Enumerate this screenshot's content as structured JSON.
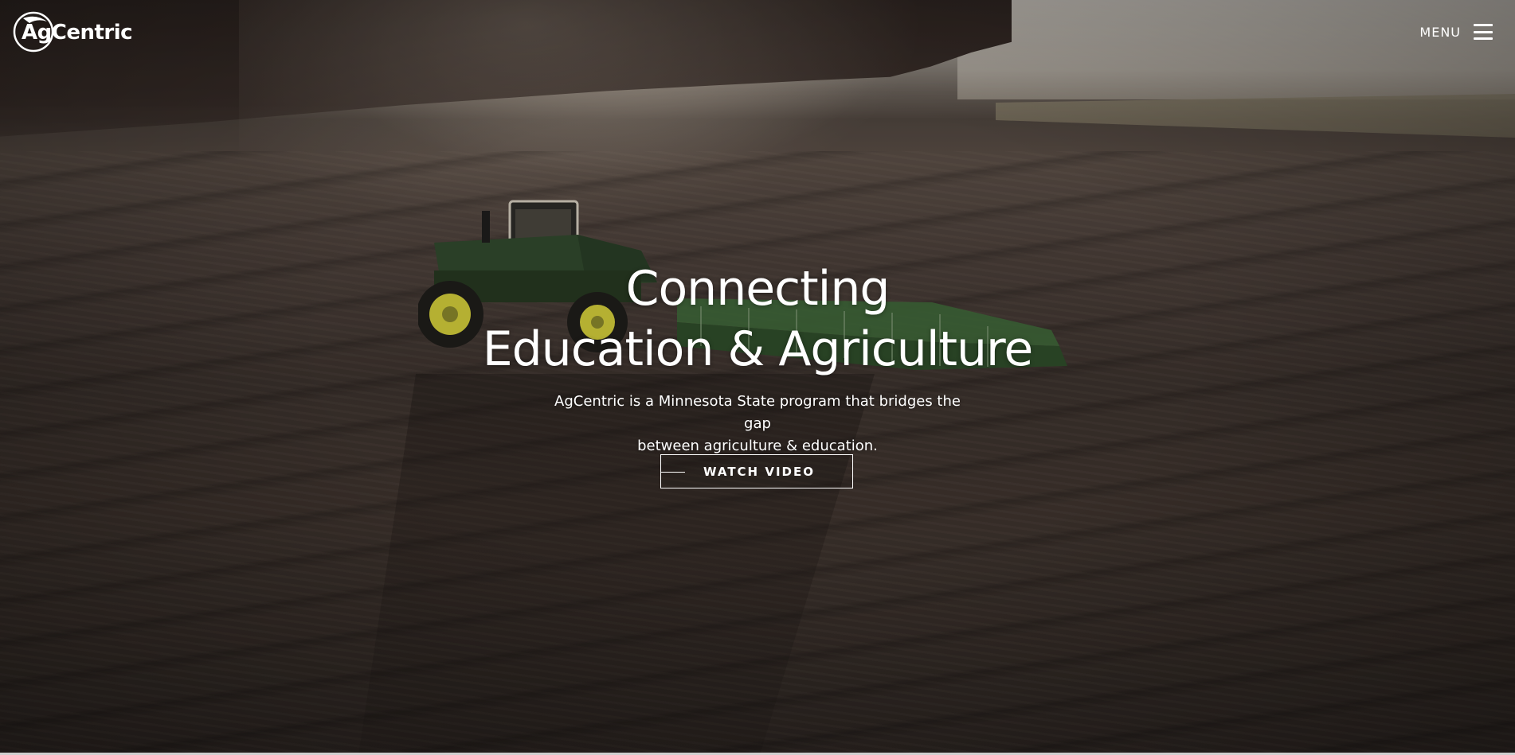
{
  "header": {
    "logo_text": "AgCentric",
    "menu_label": "MENU"
  },
  "hero": {
    "title_line1": "Connecting",
    "title_line2": "Education & Agriculture",
    "subtitle_line1": "AgCentric is a Minnesota State program that bridges the gap",
    "subtitle_line2": "between agriculture & education.",
    "cta_label": "WATCH VIDEO"
  },
  "icons": {
    "logo": "agcentric-logo-icon",
    "menu": "hamburger-menu-icon"
  },
  "colors": {
    "text": "#ffffff",
    "tractor_green": "#2f4a2c",
    "tractor_yellow": "#d8d43a"
  }
}
